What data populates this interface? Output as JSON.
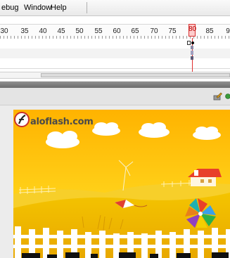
{
  "menubar": {
    "items": [
      {
        "label": "ebug"
      },
      {
        "label": "Window"
      },
      {
        "label": "Help"
      }
    ]
  },
  "timeline": {
    "ruler_labels": [
      "30",
      "35",
      "40",
      "45",
      "50",
      "55",
      "60",
      "65",
      "70",
      "75",
      "80",
      "85",
      "9"
    ],
    "current_frame": "80"
  },
  "stage_toolbar": {
    "icons": [
      "edit-scene-icon",
      "edit-symbols-icon"
    ]
  },
  "stage": {
    "brand": "aloflash.com",
    "colors": {
      "sky": "#ffc800",
      "field": "#f0b800",
      "fence": "#ffffff",
      "roof": "#e8402a"
    }
  }
}
